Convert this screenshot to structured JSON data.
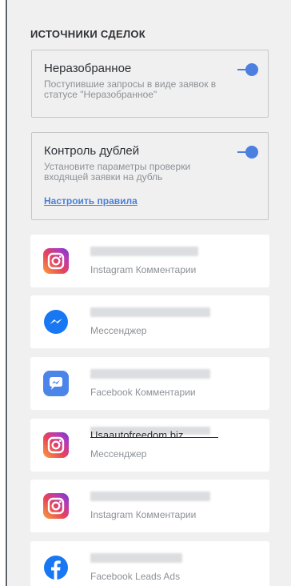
{
  "section": {
    "title": "ИСТОЧНИКИ СДЕЛОК"
  },
  "settings": [
    {
      "title": "Неразобранное",
      "description": "Поступившие запросы в виде заявок в статусе \"Неразобранное\"",
      "toggle_on": true
    },
    {
      "title": "Контроль дублей",
      "description": "Установите параметры проверки входящей заявки на дубль",
      "link": "Настроить правила",
      "toggle_on": true
    }
  ],
  "sources": [
    {
      "icon": "instagram-icon",
      "type": "Instagram Комментарии"
    },
    {
      "icon": "messenger-icon",
      "type": "Мессенджер"
    },
    {
      "icon": "facebook-comments-icon",
      "type": "Facebook Комментарии"
    },
    {
      "icon": "instagram-icon",
      "name": "Usaautofreedom.biz",
      "type": "Мессенджер"
    },
    {
      "icon": "instagram-icon",
      "type": "Instagram Комментарии"
    },
    {
      "icon": "facebook-icon",
      "type": "Facebook Leads Ads"
    }
  ],
  "colors": {
    "accent": "#4b7fe0",
    "text": "#2e3135",
    "muted": "#8d9196",
    "panel_bg": "#f0f0f0",
    "card_bg": "#ffffff",
    "messenger": "#1877f2",
    "facebook": "#1877f2"
  }
}
